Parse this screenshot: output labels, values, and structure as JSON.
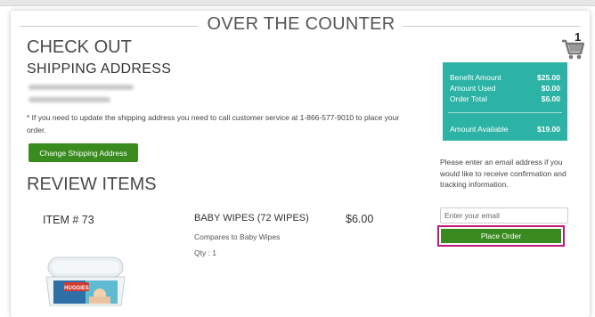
{
  "page": {
    "section_title": "OVER THE COUNTER",
    "checkout_heading": "CHECK OUT",
    "shipping_heading": "SHIPPING ADDRESS",
    "address_note": "* If you need to update the shipping address you need to call customer service at 1-866-577-9010 to place your order.",
    "change_address_button": "Change Shipping Address",
    "review_heading": "REVIEW ITEMS"
  },
  "cart": {
    "count": "1",
    "icon": "shopping-cart-icon"
  },
  "item": {
    "number": "ITEM # 73",
    "name": "BABY WIPES (72 WIPES)",
    "compare": "Compares to Baby Wipes",
    "qty": "Qty : 1",
    "price": "$6.00",
    "image_text": "HUGGIES"
  },
  "summary": {
    "benefit_label": "Benefit Amount",
    "benefit_value": "$25.00",
    "used_label": "Amount Used",
    "used_value": "$0.00",
    "total_label": "Order Total",
    "total_value": "$6.00",
    "available_label": "Amount Available",
    "available_value": "$19.00"
  },
  "email": {
    "message": "Please enter an email address if you would like to receive confirmation and tracking information.",
    "placeholder": "Enter your email",
    "value": ""
  },
  "place_order_button": "Place Order",
  "colors": {
    "accent_green": "#3a8b1f",
    "teal": "#2cb3a6",
    "highlight": "#c2187c"
  }
}
